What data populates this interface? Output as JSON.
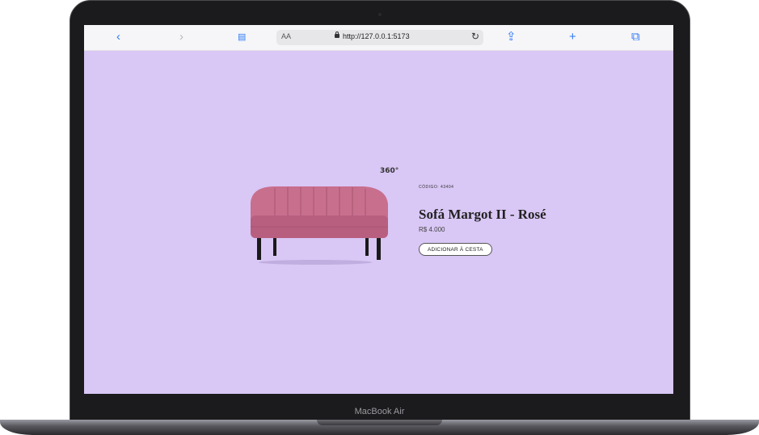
{
  "device": {
    "label": "MacBook Air"
  },
  "browser": {
    "address_prefix": "AA",
    "url": "http://127.0.0.1:5173",
    "back": "‹",
    "forward": "›",
    "bookmarks": "📖",
    "reload": "↻",
    "share": "⇪",
    "new_tab": "+",
    "tabs": "⧉"
  },
  "product": {
    "rotate_label": "360°",
    "code": "CÓDIGO: 43404",
    "title": "Sofá Margot II - Rosé",
    "price": "R$ 4.000",
    "add_to_cart": "ADICIONAR À CESTA",
    "image_icon": "sofa-image"
  },
  "colors": {
    "page_bg": "#d9c7f5",
    "sofa": "#c86f8e",
    "accent": "#2f7bf6"
  }
}
